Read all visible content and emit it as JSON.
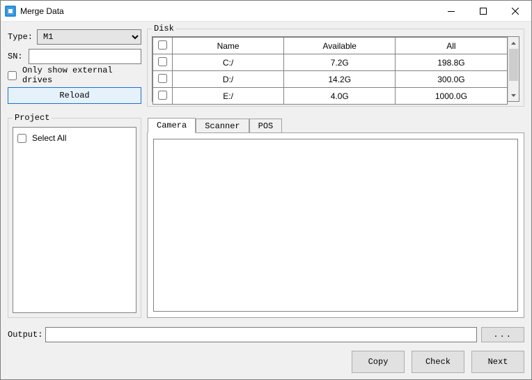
{
  "window": {
    "title": "Merge Data"
  },
  "form": {
    "type_label": "Type:",
    "type_value": "M1",
    "sn_label": "SN:",
    "sn_value": "",
    "only_external_label": "Only show external drives",
    "reload_label": "Reload"
  },
  "disk": {
    "legend": "Disk",
    "headers": {
      "name": "Name",
      "available": "Available",
      "all": "All"
    },
    "rows": [
      {
        "name": "C:/",
        "available": "7.2G",
        "all": "198.8G"
      },
      {
        "name": "D:/",
        "available": "14.2G",
        "all": "300.0G"
      },
      {
        "name": "E:/",
        "available": "4.0G",
        "all": "1000.0G"
      }
    ]
  },
  "project": {
    "legend": "Project",
    "select_all_label": "Select All"
  },
  "tabs": {
    "camera": "Camera",
    "scanner": "Scanner",
    "pos": "POS"
  },
  "output": {
    "label": "Output:",
    "value": "",
    "browse_label": "..."
  },
  "buttons": {
    "copy": "Copy",
    "check": "Check",
    "next": "Next"
  }
}
